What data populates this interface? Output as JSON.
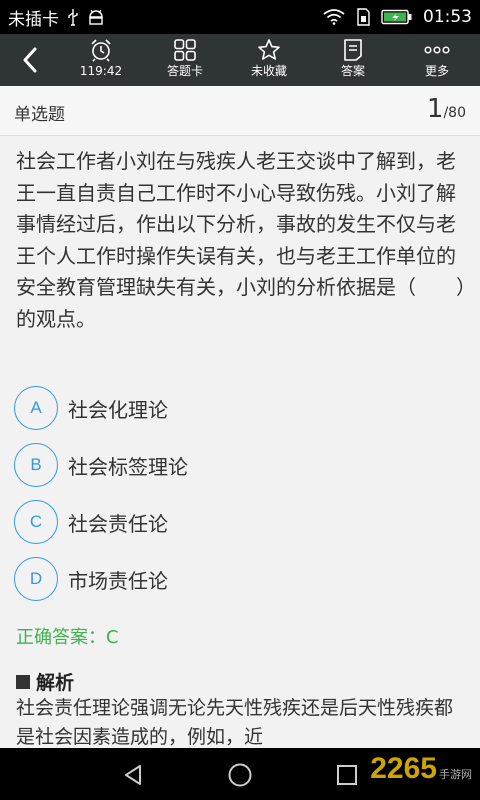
{
  "status_bar": {
    "carrier": "未插卡",
    "time": "01:53",
    "icons": [
      "usb-icon",
      "android-debug-icon",
      "wifi-icon",
      "sim-icon",
      "battery-charging-icon"
    ]
  },
  "toolbar": {
    "back_icon": "back-arrow-icon",
    "items": [
      {
        "icon": "alarm-clock-icon",
        "label": "119:42"
      },
      {
        "icon": "grid-icon",
        "label": "答题卡"
      },
      {
        "icon": "star-icon",
        "label": "未收藏"
      },
      {
        "icon": "document-icon",
        "label": "答案"
      },
      {
        "icon": "more-icon",
        "label": "更多"
      }
    ]
  },
  "question_header": {
    "type": "单选题",
    "current": "1",
    "total": "/80"
  },
  "question": {
    "text": "社会工作者小刘在与残疾人老王交谈中了解到，老王一直自责自己工作时不小心导致伤残。小刘了解事情经过后，作出以下分析，事故的发生不仅与老王个人工作时操作失误有关，也与老王工作单位的安全教育管理缺失有关，小刘的分析依据是（　　）的观点。",
    "options": [
      {
        "letter": "A",
        "text": "社会化理论"
      },
      {
        "letter": "B",
        "text": "社会标签理论"
      },
      {
        "letter": "C",
        "text": "社会责任论"
      },
      {
        "letter": "D",
        "text": "市场责任论"
      }
    ]
  },
  "answer": {
    "text": "正确答案：C",
    "color": "#3fb34f"
  },
  "analysis": {
    "title": "解析",
    "text": "社会责任理论强调无论先天性残疾还是后天性残疾都是社会因素造成的，例如，近"
  },
  "nav_bar": {
    "icons": [
      "back-triangle-icon",
      "home-circle-icon",
      "recents-square-icon"
    ]
  },
  "watermark": {
    "text": "2265",
    "sub": "手游网"
  },
  "colors": {
    "accent": "#2e9be6",
    "toolbar": "#2f3436",
    "answer": "#3fb34f"
  }
}
